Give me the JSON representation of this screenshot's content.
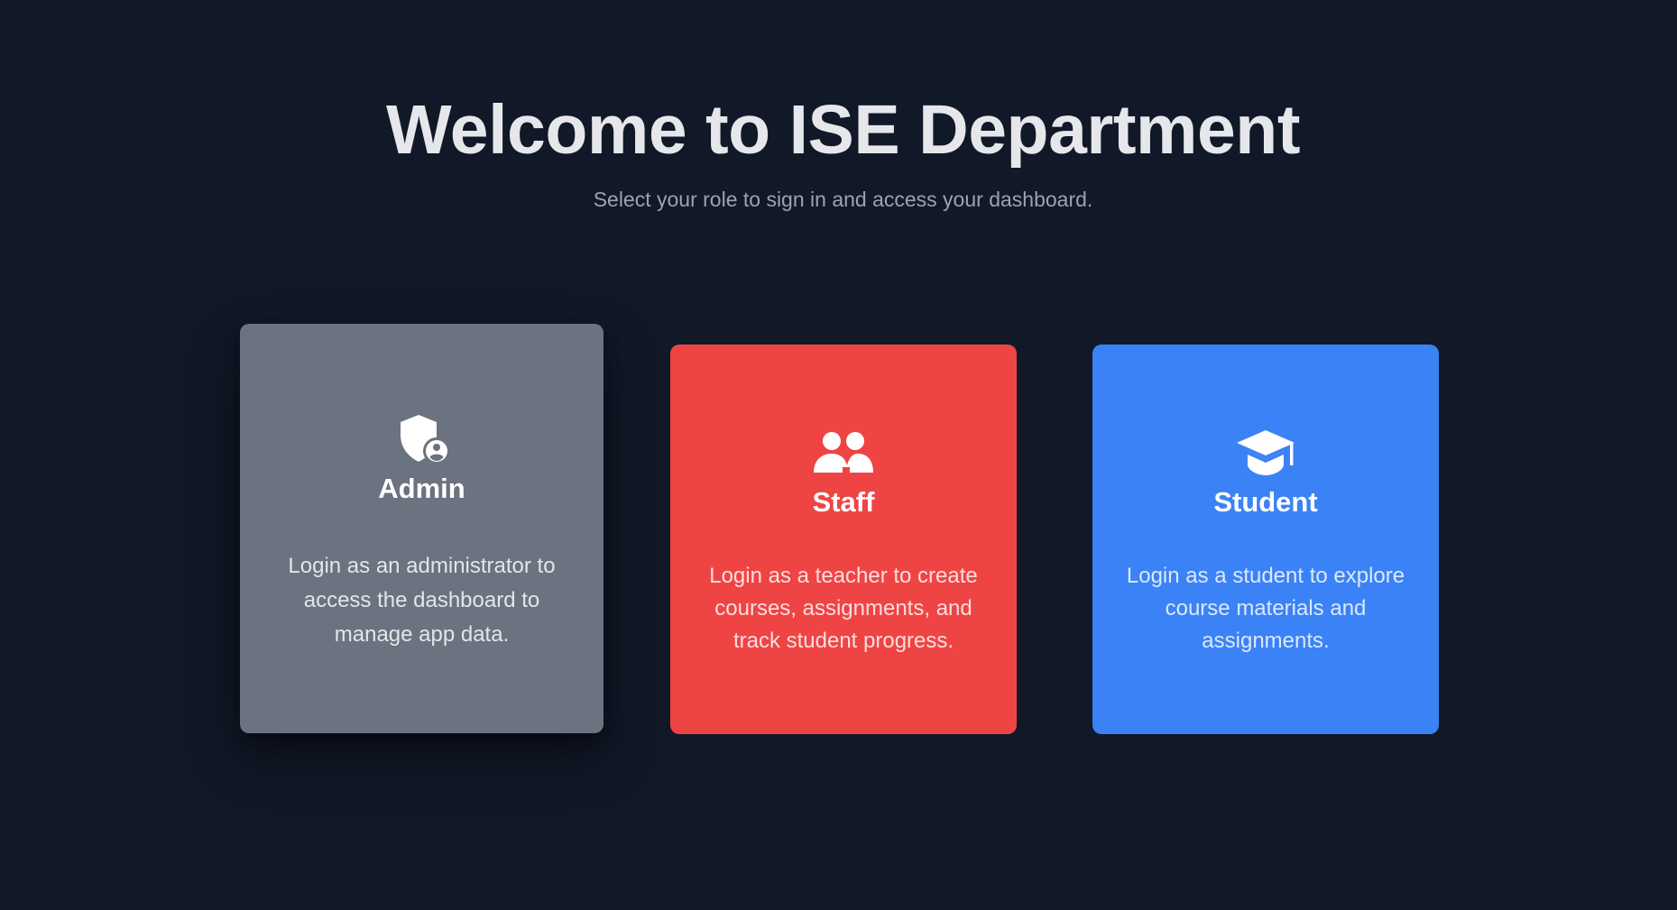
{
  "header": {
    "title": "Welcome to ISE Department",
    "subtitle": "Select your role to sign in and access your dashboard."
  },
  "roles": [
    {
      "name": "Admin",
      "description": "Login as an administrator to access the dashboard to manage app data.",
      "icon": "shield-user-icon",
      "color": "#6b7280"
    },
    {
      "name": "Staff",
      "description": "Login as a teacher to create courses, assignments, and track student progress.",
      "icon": "users-icon",
      "color": "#ef4444"
    },
    {
      "name": "Student",
      "description": "Login as a student to explore course materials and assignments.",
      "icon": "graduation-cap-icon",
      "color": "#3b82f6"
    }
  ],
  "colors": {
    "background": "#111827",
    "title": "#e5e7eb",
    "subtitle": "#9ca3af"
  }
}
